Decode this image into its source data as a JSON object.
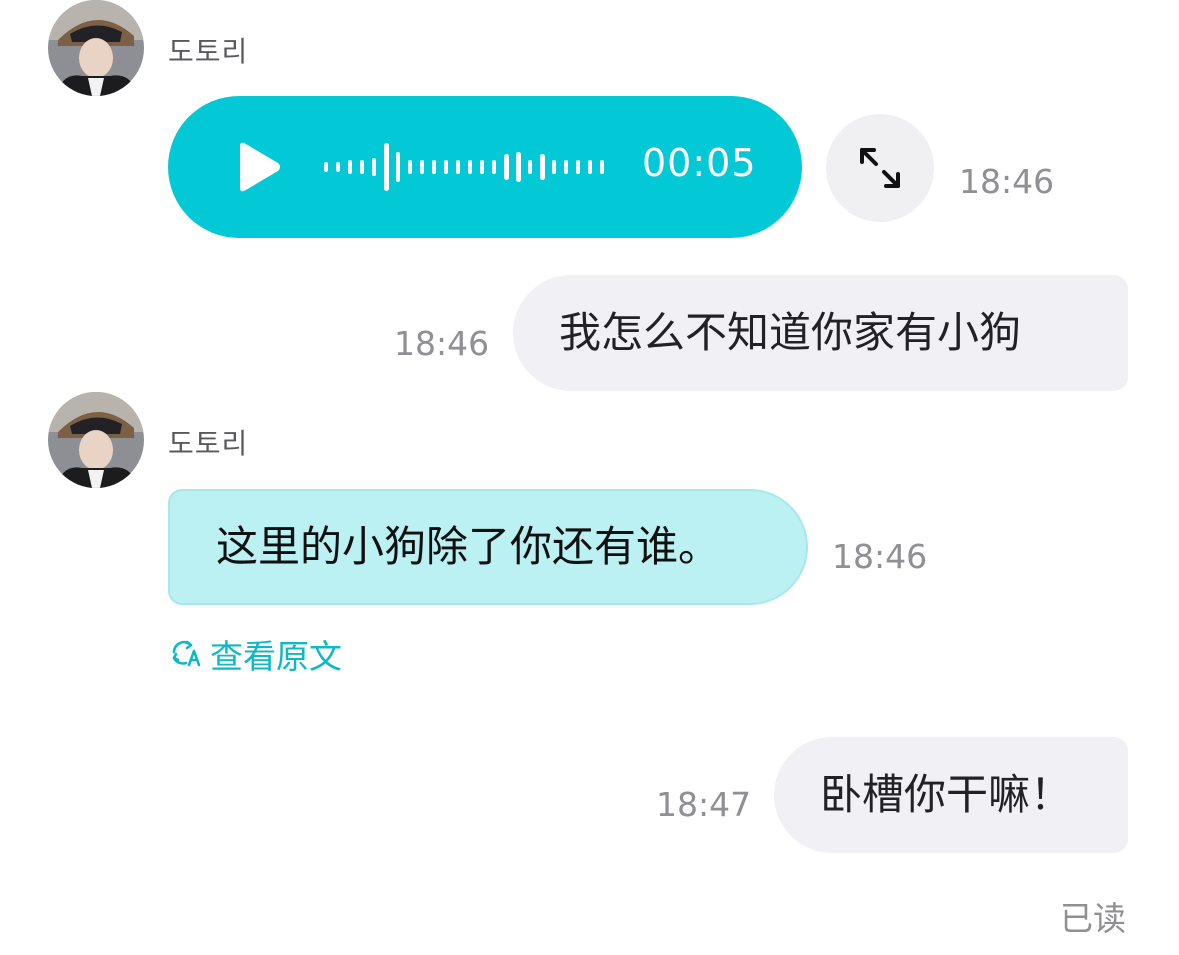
{
  "colors": {
    "voice_bubble": "#02c9d5",
    "incoming_bubble": "#bbf1f3",
    "outgoing_bubble": "#f1f1f5",
    "accent_link": "#0fb8c6",
    "timestamp": "#8f8f94"
  },
  "messages": [
    {
      "direction": "incoming",
      "type": "voice",
      "sender": "도토리",
      "avatar": "user-avatar-photo",
      "duration": "00:05",
      "play_icon": "play-icon",
      "expand_icon": "expand-arrows-icon",
      "time": "18:46"
    },
    {
      "direction": "outgoing",
      "type": "text",
      "text": "我怎么不知道你家有小狗",
      "time": "18:46"
    },
    {
      "direction": "incoming",
      "type": "text",
      "sender": "도토리",
      "avatar": "user-avatar-photo",
      "text": "这里的小狗除了你还有谁。",
      "time": "18:46",
      "translated": true,
      "view_original_label": "查看原文",
      "view_original_icon": "translate-icon"
    },
    {
      "direction": "outgoing",
      "type": "text",
      "text": "卧槽你干嘛！",
      "time": "18:47"
    }
  ],
  "read_status": "已读"
}
